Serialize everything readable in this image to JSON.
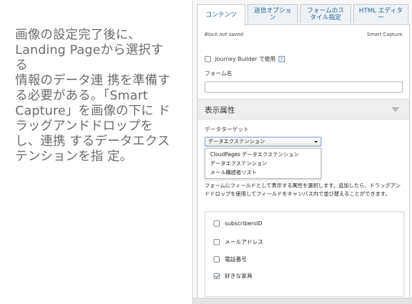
{
  "left_text": "画像の設定完了後に、\nLanding Pageから選択する\n情報のデータ連 携を準備す\nる必要がある。「Smart\nCapture」を画像の下に ド\nラッグアンドドロップを\nし、連携 するデータエクス\nテンションを指 定。",
  "tabs": [
    {
      "label": "コンテンツ",
      "active": true
    },
    {
      "label": "送信オプショ\nン",
      "active": false
    },
    {
      "label": "フォームのス\nタイル指定",
      "active": false
    },
    {
      "label": "HTML エディター",
      "active": false
    }
  ],
  "block_status": "Block not saved",
  "block_type": "Smart Capture",
  "journey_builder": {
    "label": "Journey Builder で使用",
    "checked": false,
    "help": "?"
  },
  "form_name": {
    "label": "フォーム名",
    "value": ""
  },
  "section": {
    "title": "表示属性"
  },
  "data_target": {
    "label": "データターゲット",
    "selected": "データエクステンション",
    "options": [
      "CloudPages データエクステンション",
      "データエクステンション",
      "メール購読者リスト"
    ]
  },
  "description": "フォームにフィールドとして表示する属性を選択します。追加したら、ドラッグアンドドロップを使用してフィールドをキャンバス内で並び替えることができます。",
  "fields": [
    {
      "label": "subscribersID",
      "checked": false
    },
    {
      "label": "メールアドレス",
      "checked": false
    },
    {
      "label": "電話番号",
      "checked": false
    },
    {
      "label": "好きな家具",
      "checked": true
    }
  ],
  "colors": {
    "accent": "#1f5f98",
    "select_border": "#6e97c7"
  }
}
